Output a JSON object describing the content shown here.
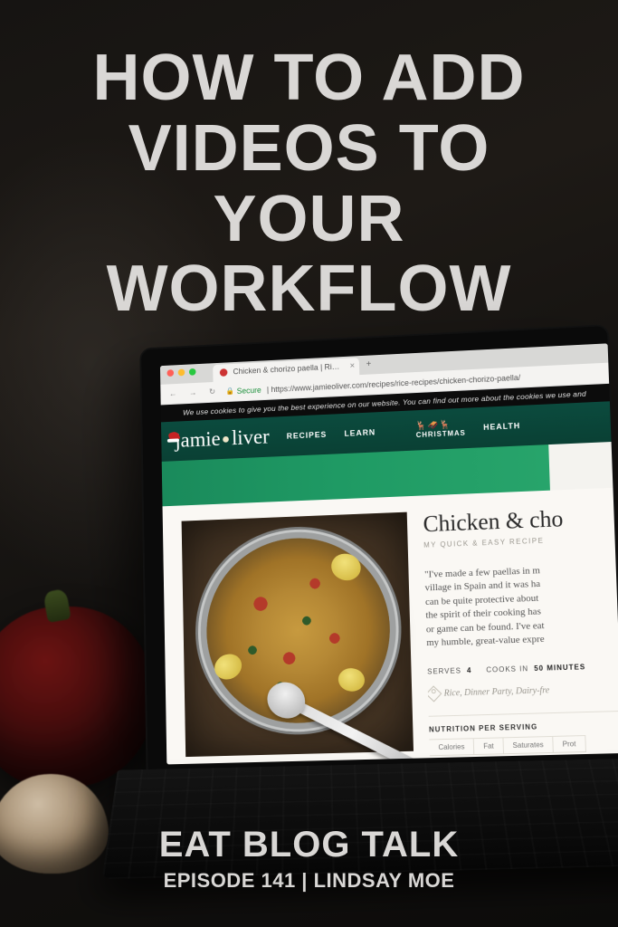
{
  "overlay": {
    "title_line1": "HOW TO ADD",
    "title_line2": "VIDEOS TO YOUR",
    "title_line3": "WORKFLOW",
    "brand": "EAT BLOG TALK",
    "episode_line": "EPISODE 141 | LINDSAY MOE"
  },
  "browser": {
    "tab_title": "Chicken & chorizo paella | Ri…",
    "secure_label": "Secure",
    "url": "https://www.jamieoliver.com/recipes/rice-recipes/chicken-chorizo-paella/",
    "cookie_notice": "We use cookies to give you the best experience on our website. You can find out more about the cookies we use and"
  },
  "site": {
    "logo_part1": "jamie",
    "logo_part2": "liver",
    "nav": {
      "recipes": "RECIPES",
      "learn": "LEARN",
      "christmas": "CHRISTMAS",
      "health": "HEALTH"
    }
  },
  "recipe": {
    "title": "Chicken & cho",
    "subtitle": "MY QUICK & EASY RECIPE",
    "quote": {
      "l1": "\"I've made a few paellas in m",
      "l2": "village in Spain and it was ha",
      "l3": "can be quite protective about",
      "l4": "the spirit of their cooking has",
      "l5": "or game can be found. I've eat",
      "l6": "my humble, great-value expre"
    },
    "serves_label": "SERVES",
    "serves_value": "4",
    "cooks_label": "COOKS IN",
    "cooks_value": "50 MINUTES",
    "tags": "Rice, Dinner Party, Dairy-fre",
    "nutrition_heading": "NUTRITION PER SERVING",
    "nutrition": {
      "c1": "Calories",
      "c2": "Fat",
      "c3": "Saturates",
      "c4": "Prot"
    }
  }
}
